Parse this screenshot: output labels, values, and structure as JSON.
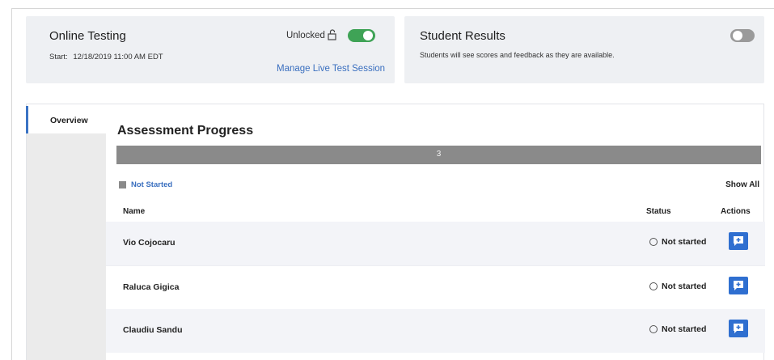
{
  "online_testing": {
    "title": "Online Testing",
    "start_label": "Start:",
    "start_value": "12/18/2019 11:00 AM EDT",
    "lock_label": "Unlocked",
    "unlocked": true,
    "manage_link": "Manage Live Test Session"
  },
  "student_results": {
    "title": "Student Results",
    "description": "Students will see scores and feedback as they are available.",
    "enabled": false
  },
  "sidebar": {
    "tabs": [
      {
        "label": "Overview",
        "active": true
      }
    ]
  },
  "assessment": {
    "title": "Assessment Progress",
    "progress_count": "3",
    "legend_label": "Not Started",
    "show_all": "Show All"
  },
  "table": {
    "columns": {
      "name": "Name",
      "status": "Status",
      "actions": "Actions"
    },
    "rows": [
      {
        "name": "Vio Cojocaru",
        "status": "Not started"
      },
      {
        "name": "Raluca Gigica",
        "status": "Not started"
      },
      {
        "name": "Claudiu Sandu",
        "status": "Not started"
      }
    ]
  },
  "colors": {
    "accent": "#3a73c4",
    "toggle_on": "#3fa356",
    "progress_gray": "#8a8a8a",
    "action_blue": "#2f6fd0"
  },
  "icons": {
    "settings": "gear-icon",
    "lock": "unlock-icon",
    "action": "comment-icon",
    "status": "circle-icon"
  }
}
